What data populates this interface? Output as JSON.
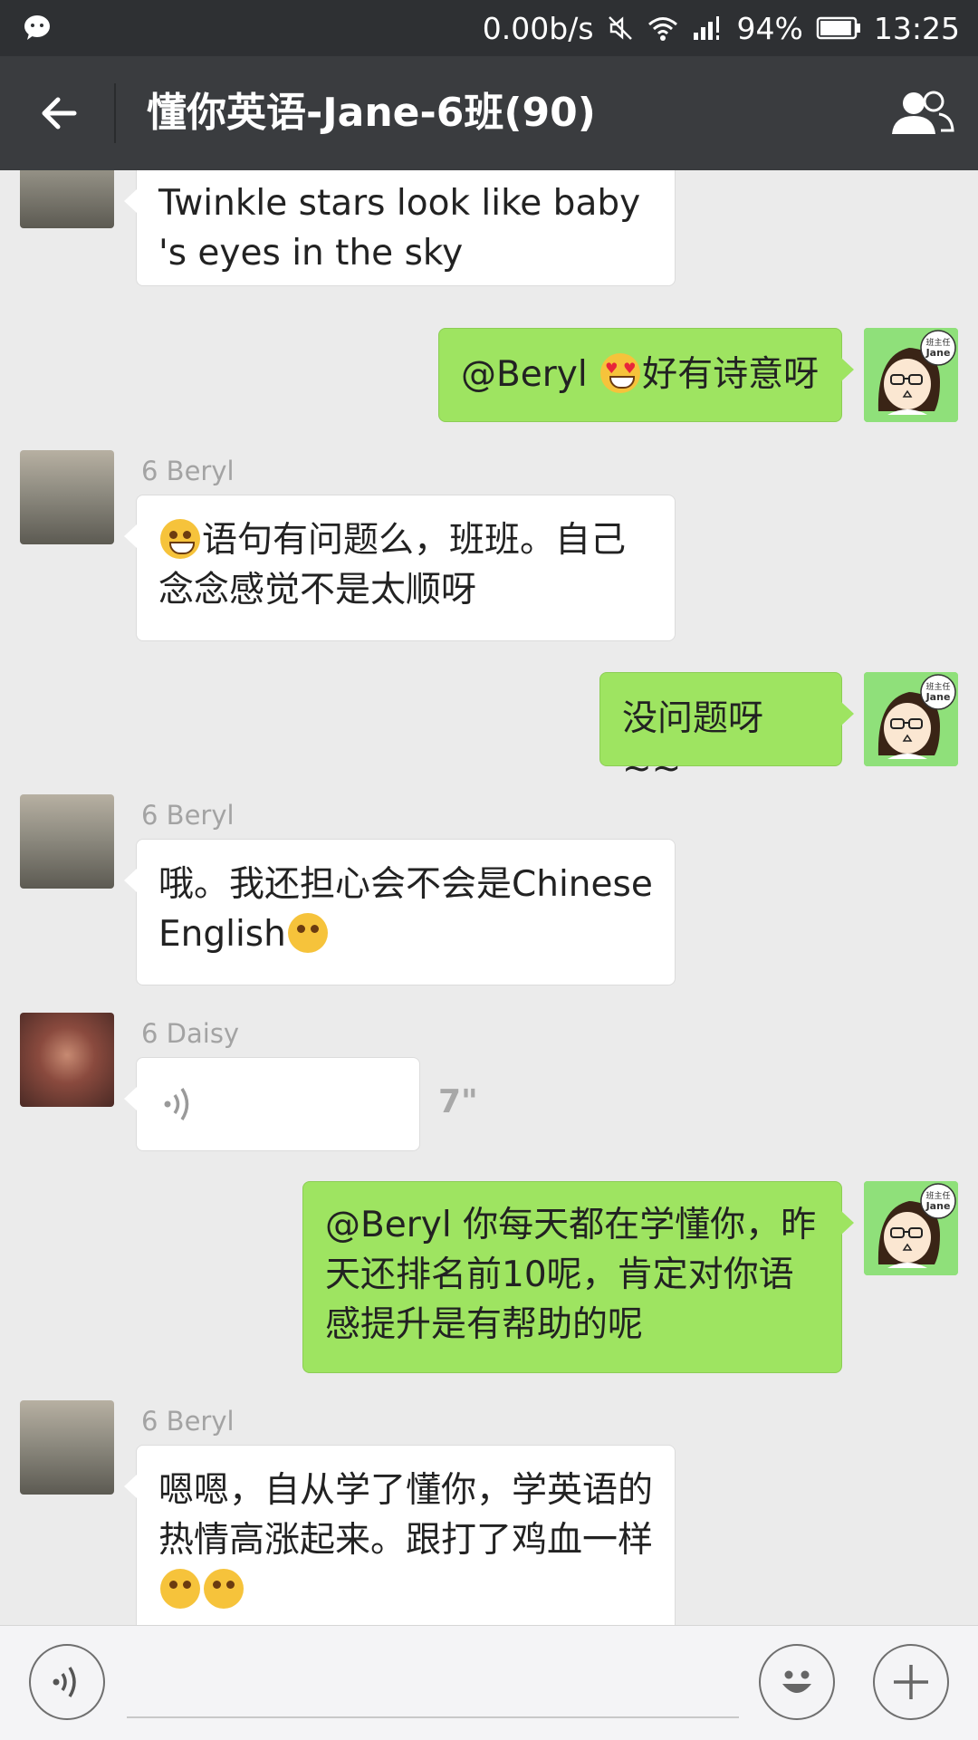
{
  "status_bar": {
    "app_icon": "wechat-icon",
    "network_speed": "0.00b/s",
    "mute_icon": "mute-icon",
    "wifi_icon": "wifi-icon",
    "signal_icon": "signal-icon",
    "battery_percent": "94%",
    "battery_level": 0.94,
    "time": "13:25"
  },
  "title_bar": {
    "back_icon": "back-arrow-icon",
    "title": "懂你英语-Jane-6班(90)",
    "members_icon": "group-members-icon"
  },
  "messages": [
    {
      "side": "left",
      "sender": "",
      "text": "Twinkle stars look like baby 's eyes in the sky",
      "avatar": "beryl"
    },
    {
      "side": "right",
      "pre": "@Beryl ",
      "emoji": "heart-eyes-emoji",
      "post": "好有诗意呀",
      "avatar": "jane"
    },
    {
      "side": "left",
      "sender": "6 Beryl",
      "emoji": "grin-emoji",
      "text": "语句有问题么，班班。自己念念感觉不是太顺呀",
      "avatar": "beryl"
    },
    {
      "side": "right",
      "text": "没问题呀~~",
      "avatar": "jane"
    },
    {
      "side": "left",
      "sender": "6 Beryl",
      "text": "哦。我还担心会不会是Chinese English",
      "emoji": "thinking-emoji",
      "avatar": "beryl"
    },
    {
      "side": "left",
      "sender": "6 Daisy",
      "voice": true,
      "duration": "7\"",
      "avatar": "daisy"
    },
    {
      "side": "right",
      "text": "@Beryl 你每天都在学懂你，昨天还排名前10呢，肯定对你语感提升是有帮助的呢",
      "avatar": "jane"
    },
    {
      "side": "left",
      "sender": "6 Beryl",
      "text": "嗯嗯，自从学了懂你，学英语的热情高涨起来。跟打了鸡血一样",
      "emoji": "thinking-emoji",
      "avatar": "beryl"
    }
  ],
  "avatar_badge": {
    "line1": "班主任",
    "line2": "Jane"
  },
  "input_bar": {
    "voice_icon": "voice-input-icon",
    "emoji_icon": "emoji-icon",
    "plus_icon": "plus-icon"
  },
  "colors": {
    "title_bar": "#3a3c3f",
    "outgoing_bubble": "#9ee461",
    "incoming_bubble": "#ffffff",
    "chat_bg": "#ebebeb"
  }
}
